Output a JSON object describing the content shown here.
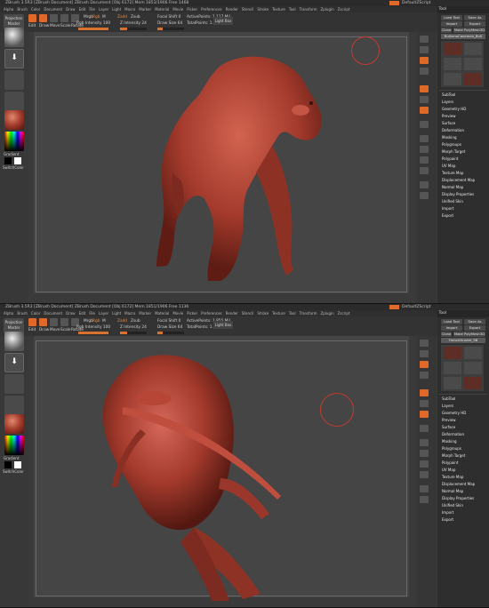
{
  "app": {
    "title_top": "ZBrush 3.5R3   [ZBrush Document]   ZBrush Document   [Obj 6172] Mem 1853/1906  Free 1468",
    "title_bottom": "ZBrush 3.5R3   [ZBrush Document]   ZBrush Document   [Obj 6172] Mem 1851/1906  Free 1136",
    "defaultzscript": "DefaultZScript",
    "menu": [
      "Alpha",
      "Brush",
      "Color",
      "Document",
      "Draw",
      "Edit",
      "File",
      "Layer",
      "Light",
      "Macro",
      "Marker",
      "Material",
      "Movie",
      "Picker",
      "Preferences",
      "Render",
      "Stencil",
      "Stroke",
      "Texture",
      "Tool",
      "Transform",
      "Zplugin",
      "Zscript"
    ]
  },
  "toolbar": {
    "projection": "Projection Master",
    "edit": "Edit",
    "draw": "Draw",
    "move": "Move",
    "scale": "Scale",
    "rotate": "Rotate",
    "mrgb": "Mrgb",
    "rgb": "Rgb",
    "m": "M",
    "zadd": "Zadd",
    "zsub": "Zsub",
    "zcut": "Zcut",
    "rgb_intensity": "Rgb Intensity 100",
    "z_intensity": "Z Intensity 24",
    "focal_shift": "Focal Shift 0",
    "draw_size": "Draw Size 64",
    "active_points_top": "ActivePoints: 1.117 Mil",
    "total_points_top": "TotalPoints: 1.117 Mil",
    "active_points_bottom": "ActivePoints: 1.855 Mil",
    "total_points_bottom": "TotalPoints: 1.855 Mil",
    "lightbox": "Light Box"
  },
  "left_shelf": {
    "gradient": "Gradient",
    "switch_color": "SwitchColor"
  },
  "tool_palette": {
    "title": "Tool",
    "load_tool": "Load Tool",
    "save_as": "Save As",
    "import": "Import",
    "export": "Export",
    "clone": "Clone",
    "make_polymesh": "Make PolyMesh3D",
    "current_top": "BullsmoCaveman_Bull",
    "current_bottom": "FrenchHunter_98",
    "thumbs": [
      "Cylinder3D",
      "SimpleBrush",
      "Plane3D",
      "PolyMesh3D",
      "PolySphere_1",
      "BullsmoCaveman",
      "FrenchHunter"
    ],
    "sections": [
      "SubTool",
      "Layers",
      "Geometry HD",
      "Preview",
      "Surface",
      "Deformation",
      "Masking",
      "Polygroups",
      "Morph Target",
      "Polypaint",
      "UV Map",
      "Texture Map",
      "Displacement Map",
      "Normal Map",
      "Display Properties",
      "Unified Skin",
      "Import",
      "Export"
    ]
  },
  "colors": {
    "accent": "#e0692a",
    "model": "#a33a2c",
    "cursor": "#c23b2e",
    "background": "#454545"
  }
}
